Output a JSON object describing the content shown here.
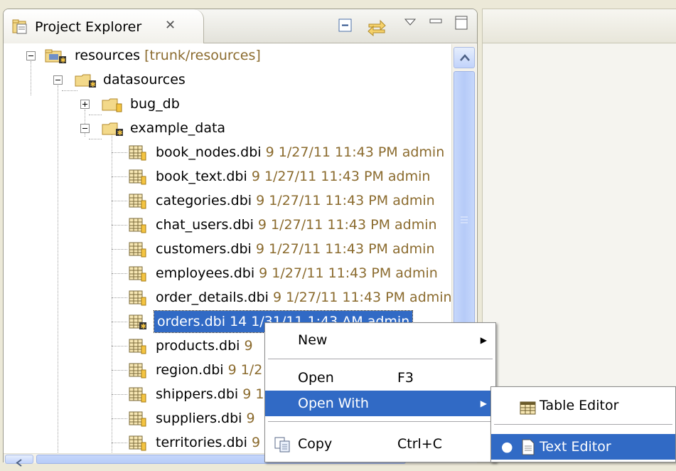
{
  "view": {
    "tab_title": "Project Explorer",
    "tab_close_glyph": "✕",
    "toolbar_icons": [
      "collapse-all-icon",
      "link-with-editor-icon",
      "view-menu-icon",
      "minimize-icon",
      "maximize-icon"
    ]
  },
  "tree": {
    "root": {
      "name": "resources",
      "decoration": "[trunk/resources]",
      "expanded": true
    },
    "datasources": {
      "name": "datasources",
      "expanded": true
    },
    "bug_db": {
      "name": "bug_db",
      "expanded": false
    },
    "example_data": {
      "name": "example_data",
      "expanded": true
    },
    "files": [
      {
        "name": "book_nodes.dbi",
        "info": "9  1/27/11 11:43 PM  admin"
      },
      {
        "name": "book_text.dbi",
        "info": "9  1/27/11 11:43 PM  admin"
      },
      {
        "name": "categories.dbi",
        "info": "9  1/27/11 11:43 PM  admin"
      },
      {
        "name": "chat_users.dbi",
        "info": "9  1/27/11 11:43 PM  admin"
      },
      {
        "name": "customers.dbi",
        "info": "9  1/27/11 11:43 PM  admin"
      },
      {
        "name": "employees.dbi",
        "info": "9  1/27/11 11:43 PM  admin"
      },
      {
        "name": "order_details.dbi",
        "info": "9  1/27/11 11:43 PM  admin"
      },
      {
        "name": "orders.dbi",
        "info": "14  1/31/11 1:43 AM  admin",
        "selected": true
      },
      {
        "name": "products.dbi",
        "info": "9"
      },
      {
        "name": "region.dbi",
        "info": "9  1/2"
      },
      {
        "name": "shippers.dbi",
        "info": "9  1"
      },
      {
        "name": "suppliers.dbi",
        "info": "9"
      },
      {
        "name": "territories.dbi",
        "info": "9"
      }
    ]
  },
  "context_menu": {
    "items": [
      {
        "label": "New",
        "accel": "",
        "submenu": true
      },
      {
        "label": "Open",
        "accel": "F3",
        "submenu": false
      },
      {
        "label": "Open With",
        "accel": "",
        "submenu": true,
        "highlighted": true
      },
      {
        "label": "Copy",
        "accel": "Ctrl+C",
        "submenu": false
      }
    ]
  },
  "open_with_menu": {
    "items": [
      {
        "label": "Table Editor",
        "checked": false
      },
      {
        "label": "Text Editor",
        "checked": true,
        "highlighted": true
      }
    ]
  },
  "colors": {
    "selection": "#316ac5",
    "decoration": "#8b6b2e",
    "background": "#ece9d8"
  }
}
